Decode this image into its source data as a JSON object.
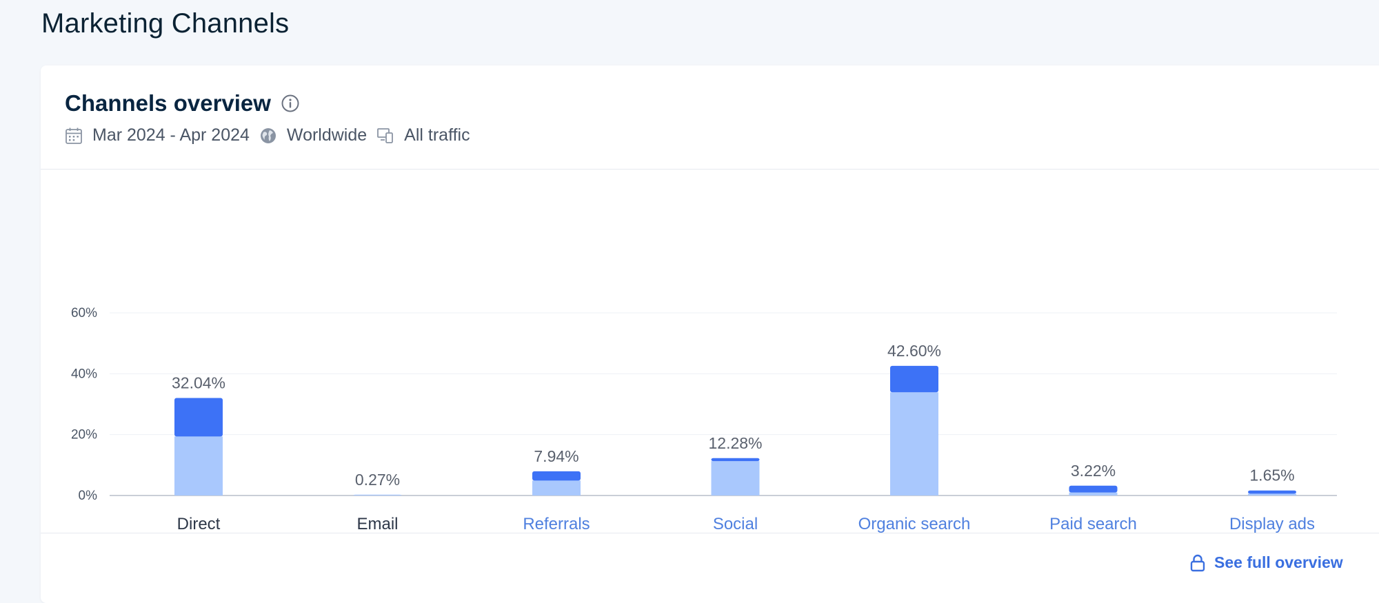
{
  "page": {
    "title": "Marketing Channels"
  },
  "card": {
    "title": "Channels overview",
    "date_range": "Mar 2024 - Apr 2024",
    "region": "Worldwide",
    "traffic": "All traffic",
    "see_full_label": "See full overview"
  },
  "icons": {
    "info": "info-icon",
    "calendar": "calendar-icon",
    "globe": "globe-icon",
    "devices": "devices-icon",
    "lock": "lock-icon"
  },
  "colors": {
    "bar_dark": "#3d72f6",
    "bar_light": "#a9c8fd",
    "link_label": "#4f80df",
    "plain_label": "#2d3748",
    "value_label": "#59606d",
    "axis_label": "#4a5565"
  },
  "chart_data": {
    "type": "bar",
    "stacked": true,
    "categories": [
      "Direct",
      "Email",
      "Referrals",
      "Social",
      "Organic search",
      "Paid search",
      "Display ads"
    ],
    "category_links": [
      false,
      false,
      true,
      true,
      true,
      true,
      true
    ],
    "totals_labels": [
      "32.04%",
      "0.27%",
      "7.94%",
      "12.28%",
      "42.60%",
      "3.22%",
      "1.65%"
    ],
    "series": [
      {
        "values": [
          19.4,
          0.27,
          4.9,
          11.3,
          33.9,
          1.0,
          0.6
        ]
      },
      {
        "values": [
          12.64,
          0,
          3.04,
          0.98,
          8.7,
          2.22,
          1.05
        ]
      }
    ],
    "y_ticks": [
      "0%",
      "20%",
      "40%",
      "60%"
    ],
    "ylim": [
      0,
      60
    ],
    "grid": true
  }
}
